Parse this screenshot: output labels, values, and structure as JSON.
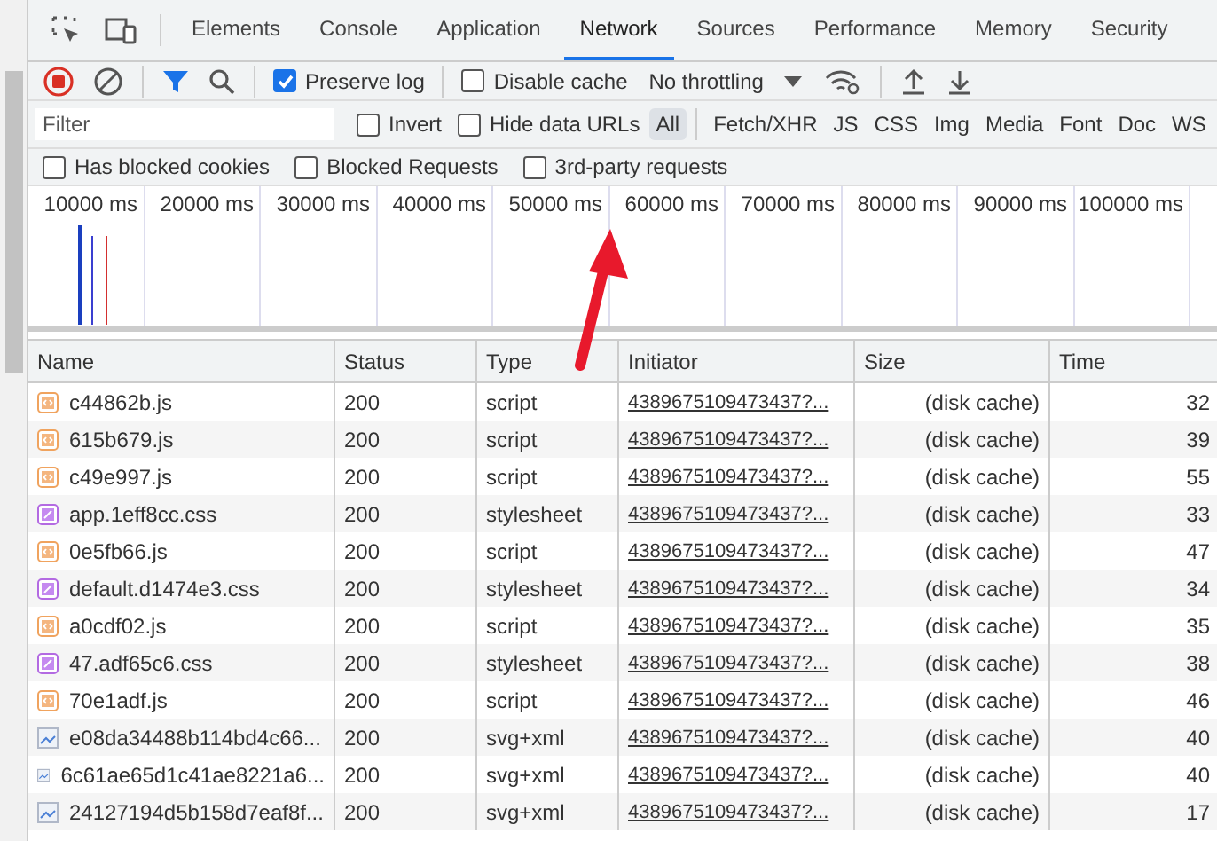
{
  "tabs": [
    {
      "label": "Elements",
      "selected": false
    },
    {
      "label": "Console",
      "selected": false
    },
    {
      "label": "Application",
      "selected": false
    },
    {
      "label": "Network",
      "selected": true
    },
    {
      "label": "Sources",
      "selected": false
    },
    {
      "label": "Performance",
      "selected": false
    },
    {
      "label": "Memory",
      "selected": false
    },
    {
      "label": "Security",
      "selected": false
    }
  ],
  "toolbar": {
    "preserve_log": {
      "label": "Preserve log",
      "checked": true
    },
    "disable_cache": {
      "label": "Disable cache",
      "checked": false
    },
    "throttling": "No throttling"
  },
  "filter": {
    "placeholder": "Filter",
    "options": [
      {
        "label": "Invert",
        "checked": false
      },
      {
        "label": "Hide data URLs",
        "checked": false
      }
    ],
    "types": [
      {
        "label": "All",
        "selected": true
      },
      {
        "label": "Fetch/XHR",
        "selected": false
      },
      {
        "label": "JS",
        "selected": false
      },
      {
        "label": "CSS",
        "selected": false
      },
      {
        "label": "Img",
        "selected": false
      },
      {
        "label": "Media",
        "selected": false
      },
      {
        "label": "Font",
        "selected": false
      },
      {
        "label": "Doc",
        "selected": false
      },
      {
        "label": "WS",
        "selected": false
      }
    ],
    "more_options": [
      {
        "label": "Has blocked cookies",
        "checked": false
      },
      {
        "label": "Blocked Requests",
        "checked": false
      },
      {
        "label": "3rd-party requests",
        "checked": false
      }
    ]
  },
  "timeline": {
    "ticks": [
      "10000 ms",
      "20000 ms",
      "30000 ms",
      "40000 ms",
      "50000 ms",
      "60000 ms",
      "70000 ms",
      "80000 ms",
      "90000 ms",
      "100000 ms"
    ]
  },
  "table": {
    "columns": [
      "Name",
      "Status",
      "Type",
      "Initiator",
      "Size",
      "Time"
    ],
    "rows": [
      {
        "kind": "script",
        "name": "c44862b.js",
        "status": "200",
        "type": "script",
        "initiator": "4389675109473437?...",
        "size": "(disk cache)",
        "time": "32"
      },
      {
        "kind": "script",
        "name": "615b679.js",
        "status": "200",
        "type": "script",
        "initiator": "4389675109473437?...",
        "size": "(disk cache)",
        "time": "39"
      },
      {
        "kind": "script",
        "name": "c49e997.js",
        "status": "200",
        "type": "script",
        "initiator": "4389675109473437?...",
        "size": "(disk cache)",
        "time": "55"
      },
      {
        "kind": "stylesheet",
        "name": "app.1eff8cc.css",
        "status": "200",
        "type": "stylesheet",
        "initiator": "4389675109473437?...",
        "size": "(disk cache)",
        "time": "33"
      },
      {
        "kind": "script",
        "name": "0e5fb66.js",
        "status": "200",
        "type": "script",
        "initiator": "4389675109473437?...",
        "size": "(disk cache)",
        "time": "47"
      },
      {
        "kind": "stylesheet",
        "name": "default.d1474e3.css",
        "status": "200",
        "type": "stylesheet",
        "initiator": "4389675109473437?...",
        "size": "(disk cache)",
        "time": "34"
      },
      {
        "kind": "script",
        "name": "a0cdf02.js",
        "status": "200",
        "type": "script",
        "initiator": "4389675109473437?...",
        "size": "(disk cache)",
        "time": "35"
      },
      {
        "kind": "stylesheet",
        "name": "47.adf65c6.css",
        "status": "200",
        "type": "stylesheet",
        "initiator": "4389675109473437?...",
        "size": "(disk cache)",
        "time": "38"
      },
      {
        "kind": "script",
        "name": "70e1adf.js",
        "status": "200",
        "type": "script",
        "initiator": "4389675109473437?...",
        "size": "(disk cache)",
        "time": "46"
      },
      {
        "kind": "image",
        "name": "e08da34488b114bd4c66...",
        "status": "200",
        "type": "svg+xml",
        "initiator": "4389675109473437?...",
        "size": "(disk cache)",
        "time": "40"
      },
      {
        "kind": "image",
        "name": "6c61ae65d1c41ae8221a6...",
        "status": "200",
        "type": "svg+xml",
        "initiator": "4389675109473437?...",
        "size": "(disk cache)",
        "time": "40"
      },
      {
        "kind": "image",
        "name": "24127194d5b158d7eaf8f...",
        "status": "200",
        "type": "svg+xml",
        "initiator": "4389675109473437?...",
        "size": "(disk cache)",
        "time": "17"
      }
    ]
  }
}
